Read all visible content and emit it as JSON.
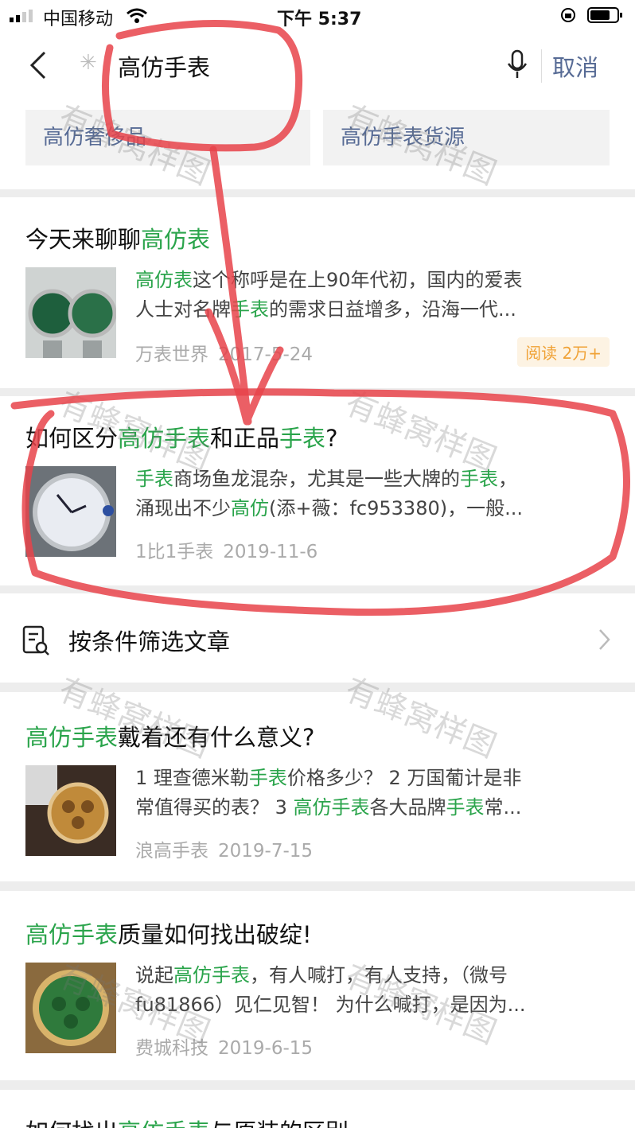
{
  "status_bar": {
    "carrier": "中国移动",
    "time": "下午 5:37"
  },
  "search": {
    "query": "高仿手表",
    "cancel_label": "取消"
  },
  "suggestions": [
    "高仿奢侈品",
    "高仿手表货源"
  ],
  "filter_label": "按条件筛选文章",
  "watermark": "有蜂窝样图",
  "articles": [
    {
      "title": [
        {
          "t": "今天来聊聊"
        },
        {
          "t": "高仿表",
          "hl": true
        }
      ],
      "line1": [
        {
          "t": "高仿表",
          "hl": true
        },
        {
          "t": "这个称呼是在上90年代初，国内的爱表"
        }
      ],
      "line2": [
        {
          "t": "人士对名牌"
        },
        {
          "t": "手表",
          "hl": true
        },
        {
          "t": "的需求日益增多，沿海一代..."
        }
      ],
      "source": "万表世界",
      "date": "2017-5-24",
      "badge": "阅读 2万+"
    },
    {
      "title": [
        {
          "t": "如何区分"
        },
        {
          "t": "高仿手表",
          "hl": true
        },
        {
          "t": "和正品"
        },
        {
          "t": "手表",
          "hl": true
        },
        {
          "t": "?"
        }
      ],
      "line1": [
        {
          "t": "手表",
          "hl": true
        },
        {
          "t": "商场鱼龙混杂，尤其是一些大牌的"
        },
        {
          "t": "手表",
          "hl": true
        },
        {
          "t": "，"
        }
      ],
      "line2": [
        {
          "t": "涌现出不少"
        },
        {
          "t": "高仿",
          "hl": true
        },
        {
          "t": "(添+薇：fc953380)，一般..."
        }
      ],
      "source": "1比1手表",
      "date": "2019-11-6"
    },
    {
      "title": [
        {
          "t": "高仿手表",
          "hl": true
        },
        {
          "t": "戴着还有什么意义?"
        }
      ],
      "line1": [
        {
          "t": "1 理查德米勒"
        },
        {
          "t": "手表",
          "hl": true
        },
        {
          "t": "价格多少？ 2 万国葡计是非"
        }
      ],
      "line2": [
        {
          "t": "常值得买的表？ 3 "
        },
        {
          "t": "高仿手表",
          "hl": true
        },
        {
          "t": "各大品牌"
        },
        {
          "t": "手表",
          "hl": true
        },
        {
          "t": "常..."
        }
      ],
      "source": "浪高手表",
      "date": "2019-7-15"
    },
    {
      "title": [
        {
          "t": "高仿手表",
          "hl": true
        },
        {
          "t": "质量如何找出破绽!"
        }
      ],
      "line1": [
        {
          "t": "说起"
        },
        {
          "t": "高仿手表",
          "hl": true
        },
        {
          "t": "，有人喊打，有人支持，（微号"
        }
      ],
      "line2": [
        {
          "t": "fu81866）见仁见智！ 为什么喊打，是因为..."
        }
      ],
      "source": "费城科技",
      "date": "2019-6-15"
    },
    {
      "title": [
        {
          "t": "如何找出"
        },
        {
          "t": "高仿手表",
          "hl": true
        },
        {
          "t": "与原装的区别"
        }
      ]
    }
  ],
  "colors": {
    "highlight": "#2aa44b",
    "link": "#576b95",
    "annotation": "#e8434a"
  }
}
